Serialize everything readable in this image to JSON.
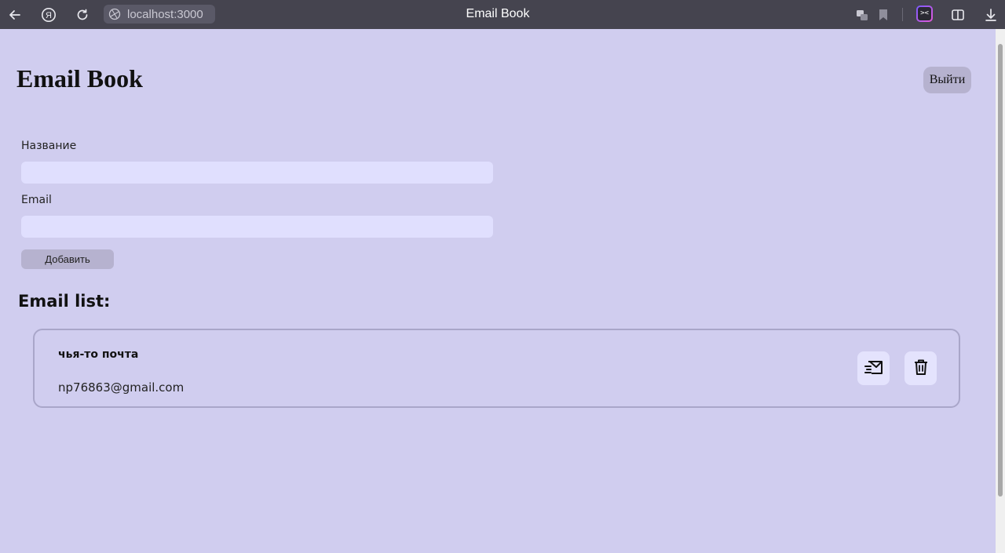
{
  "browser": {
    "url": "localhost:3000",
    "tab_title": "Email Book",
    "yandex_icon": "yandex-logo-icon",
    "icons": [
      "back-arrow-icon",
      "yandex-logo-icon",
      "reload-icon",
      "globe-icon",
      "translate-icon",
      "bookmark-icon",
      "extension-icon",
      "split-view-icon",
      "download-icon"
    ]
  },
  "header": {
    "title": "Email Book",
    "logout_label": "Выйти"
  },
  "form": {
    "name_label": "Название",
    "name_value": "",
    "email_label": "Email",
    "email_value": "",
    "add_label": "Добавить"
  },
  "list": {
    "heading": "Email list:",
    "items": [
      {
        "name": "чья-то почта",
        "email": "np76863@gmail.com"
      }
    ]
  },
  "colors": {
    "page_background": "#d0cdef",
    "browser_bar": "#45444f",
    "input_background": "#e0dffe",
    "button_background": "#b6b2cf",
    "card_border": "#a9a6c9"
  }
}
